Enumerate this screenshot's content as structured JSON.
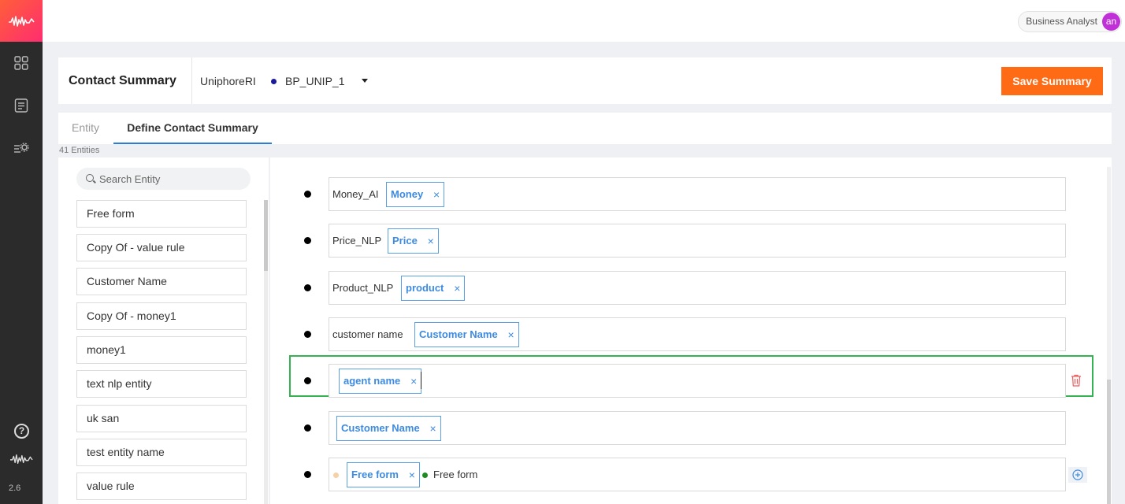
{
  "rail": {
    "icons": [
      "waveform-logo-icon",
      "dashboard-grid-icon",
      "document-list-icon",
      "settings-list-icon",
      "help-circle-icon",
      "waveform-icon"
    ],
    "version": "2.6"
  },
  "topbar": {
    "role": "Business Analyst",
    "avatar_initials": "an"
  },
  "header": {
    "title": "Contact Summary",
    "project": "UniphoreRI",
    "variant": "BP_UNIP_1",
    "save_label": "Save Summary"
  },
  "tabs": {
    "entity": "Entity",
    "define": "Define Contact Summary"
  },
  "entity_count": "41 Entities",
  "search": {
    "placeholder": "Search Entity"
  },
  "entities": [
    "Free form",
    "Copy Of - value rule",
    "Customer Name",
    "Copy Of - money1",
    "money1",
    "text nlp entity",
    "uk san",
    "test entity name",
    "value rule"
  ],
  "rules": [
    {
      "label": "Money_AI",
      "chip": "Money"
    },
    {
      "label": "Price_NLP",
      "chip": "Price"
    },
    {
      "label": "Product_NLP",
      "chip": "product"
    },
    {
      "label": "customer name",
      "chip": "Customer Name"
    },
    {
      "label": "",
      "chip": "agent name"
    },
    {
      "label": "",
      "chip": "Customer Name"
    },
    {
      "label": "",
      "chip": "Free form",
      "text": "Free form"
    }
  ],
  "chip_close": "×",
  "colors": {
    "accent_orange": "#ff6a14",
    "chip_blue": "#3d8be0",
    "active_green": "#35b352",
    "rail_dark": "#2b2b2b",
    "tab_underline": "#2a7fd4",
    "avatar": "#c12fd8"
  }
}
